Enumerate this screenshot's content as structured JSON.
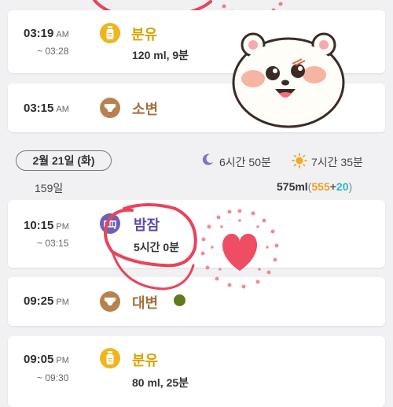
{
  "records": [
    {
      "time": "03:19",
      "ampm": "AM",
      "end": "~ 03:28",
      "title": "분유",
      "detail": "120 ml, 9분",
      "icon": "bottle-icon"
    },
    {
      "time": "03:15",
      "ampm": "AM",
      "title": "소변",
      "icon": "diaper-icon"
    },
    {
      "time": "10:15",
      "ampm": "PM",
      "end": "~ 03:15",
      "title": "밤잠",
      "detail": "5시간 0분",
      "icon": "crib-icon"
    },
    {
      "time": "09:25",
      "ampm": "PM",
      "title": "대변",
      "icon": "diaper-icon",
      "stool_color": "#5f7a1f"
    },
    {
      "time": "09:05",
      "ampm": "PM",
      "end": "~ 09:30",
      "title": "분유",
      "detail": "80 ml, 25분",
      "icon": "bottle-icon"
    }
  ],
  "day_summary": {
    "date": "2월 21일 (화)",
    "day_count": "159일",
    "night_sleep": "6시간 50분",
    "day_sleep": "7시간 35분",
    "total_ml": "575ml",
    "paren_open": "(",
    "formula_ml": "555",
    "plus": "+",
    "other_ml": "20",
    "paren_close": ")"
  },
  "colors": {
    "feed_title": "#d9a300",
    "sleep_title": "#5a4aa8",
    "diaper_title": "#a0703d",
    "bottle_bg": "#f0b41c",
    "diaper_bg": "#b88250",
    "crib_bg": "#6e60b8",
    "annotation_red": "#e8445a",
    "formula_orange": "#f0a020",
    "other_teal": "#2fb8c8"
  }
}
